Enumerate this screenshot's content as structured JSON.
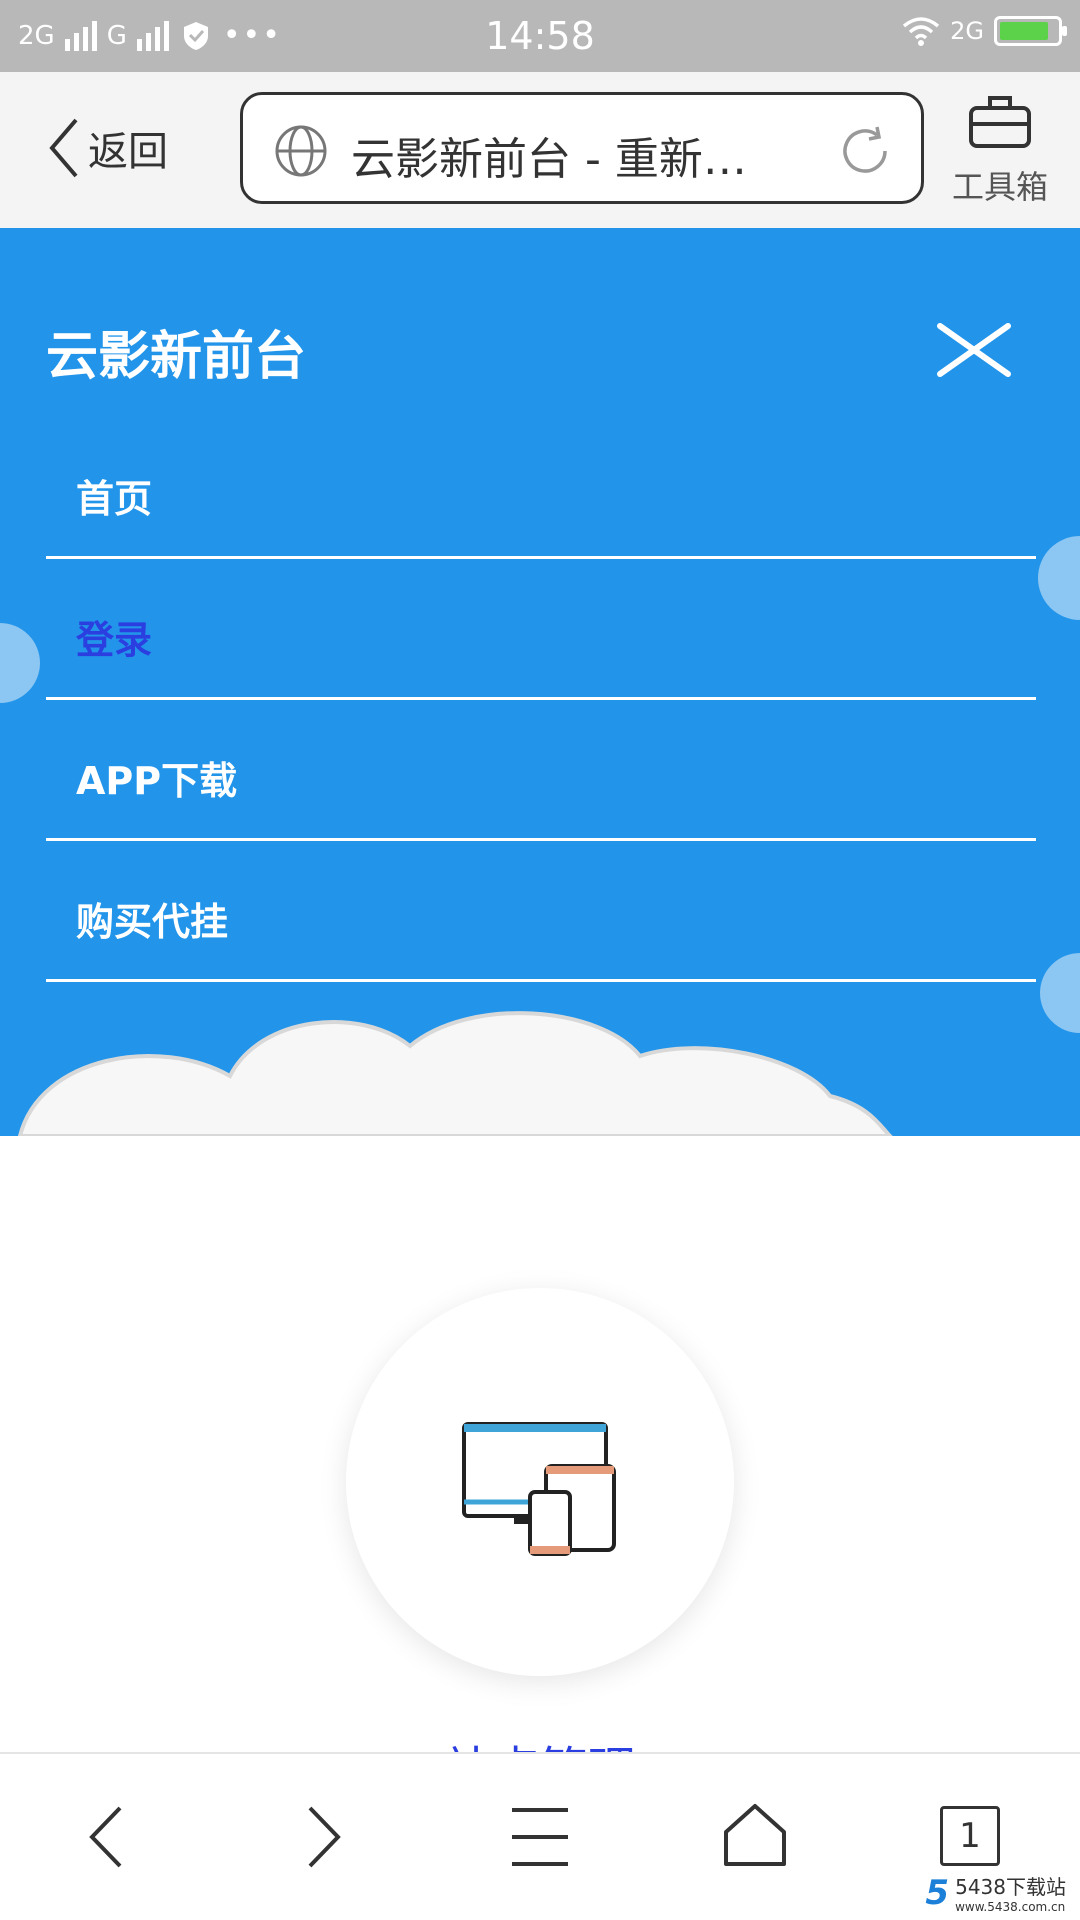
{
  "status_bar": {
    "network_1": "2G",
    "network_2": "G",
    "time": "14:58",
    "network_3": "2G",
    "battery_level": 0.85,
    "colors": {
      "bg": "#b8b8b8",
      "battery": "#5bd24a"
    }
  },
  "browser": {
    "back_label": "返回",
    "url_title": "云影新前台 - 重新…",
    "toolbox_label": "工具箱",
    "icons": [
      "chevron-left-icon",
      "globe-icon",
      "refresh-icon",
      "toolbox-icon"
    ]
  },
  "nav": {
    "site_title": "云影新前台",
    "items": [
      {
        "label": "首页",
        "active": false
      },
      {
        "label": "登录",
        "active": true
      },
      {
        "label": "APP下载",
        "active": false
      },
      {
        "label": "购买代挂",
        "active": false
      }
    ],
    "colors": {
      "panel": "#2295ea",
      "active_text": "#2b3fe0"
    }
  },
  "content": {
    "feature_title": "站点管理",
    "icon": "devices-icon"
  },
  "bottom_bar": {
    "tab_count": "1",
    "icons": [
      "back-arrow-icon",
      "forward-arrow-icon",
      "menu-icon",
      "home-icon"
    ]
  },
  "watermark": {
    "logo": "5",
    "text": "5438下载站",
    "sub": "www.5438.com.cn"
  }
}
